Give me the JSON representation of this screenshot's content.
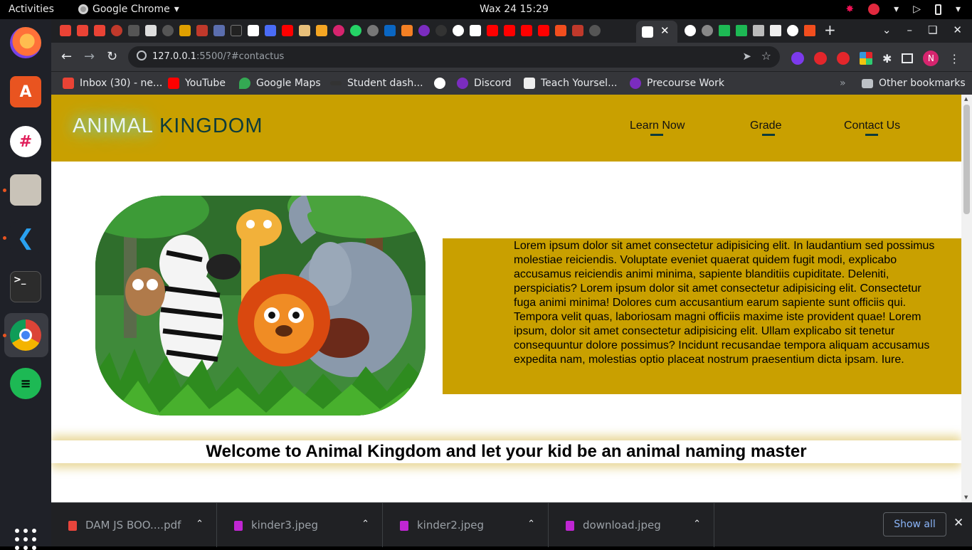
{
  "system": {
    "activities": "Activities",
    "app_name": "Google Chrome",
    "clock": "Wax 24  15:29"
  },
  "browser": {
    "url_host": "127.0.0.1",
    "url_rest": ":5500/?#contactus",
    "profile_initial": "N",
    "bookmarks": [
      {
        "label": "Inbox (30) - ne..."
      },
      {
        "label": "YouTube"
      },
      {
        "label": "Google Maps"
      },
      {
        "label": "Student dash..."
      },
      {
        "label": "Discord"
      },
      {
        "label": "Teach Yoursel..."
      },
      {
        "label": "Precourse Work"
      }
    ],
    "other_bookmarks": "Other bookmarks",
    "more_bookmarks": "»"
  },
  "site": {
    "logo_part1": "ANIMAL ",
    "logo_part2": "KINGDOM",
    "nav": [
      {
        "label": "Learn Now"
      },
      {
        "label": "Grade"
      },
      {
        "label": "Contact Us"
      }
    ],
    "paragraph": "Lorem ipsum dolor sit amet consectetur adipisicing elit. In laudantium sed possimus molestiae reiciendis. Voluptate eveniet quaerat quidem fugit modi, explicabo accusamus reiciendis animi minima, sapiente blanditiis cupiditate. Deleniti, perspiciatis? Lorem ipsum dolor sit amet consectetur adipisicing elit. Consectetur fuga animi minima! Dolores cum accusantium earum sapiente sunt officiis qui. Tempora velit quas, laboriosam magni officiis maxime iste provident quae! Lorem ipsum, dolor sit amet consectetur adipisicing elit. Ullam explicabo sit tenetur consequuntur dolore possimus? Incidunt recusandae tempora aliquam accusamus expedita nam, molestias optio placeat nostrum praesentium dicta ipsam. Iure.",
    "welcome": "Welcome to Animal Kingdom and let your kid be an animal naming master"
  },
  "downloads": {
    "items": [
      {
        "name": "DAM JS BOO....pdf",
        "icon": "pdf-icon"
      },
      {
        "name": "kinder3.jpeg",
        "icon": "image-file-icon"
      },
      {
        "name": "kinder2.jpeg",
        "icon": "image-file-icon"
      },
      {
        "name": "download.jpeg",
        "icon": "image-file-icon"
      }
    ],
    "show_all": "Show all"
  },
  "colors": {
    "brand_yellow": "#c9a000",
    "logo_teal": "#0d3b3b"
  }
}
